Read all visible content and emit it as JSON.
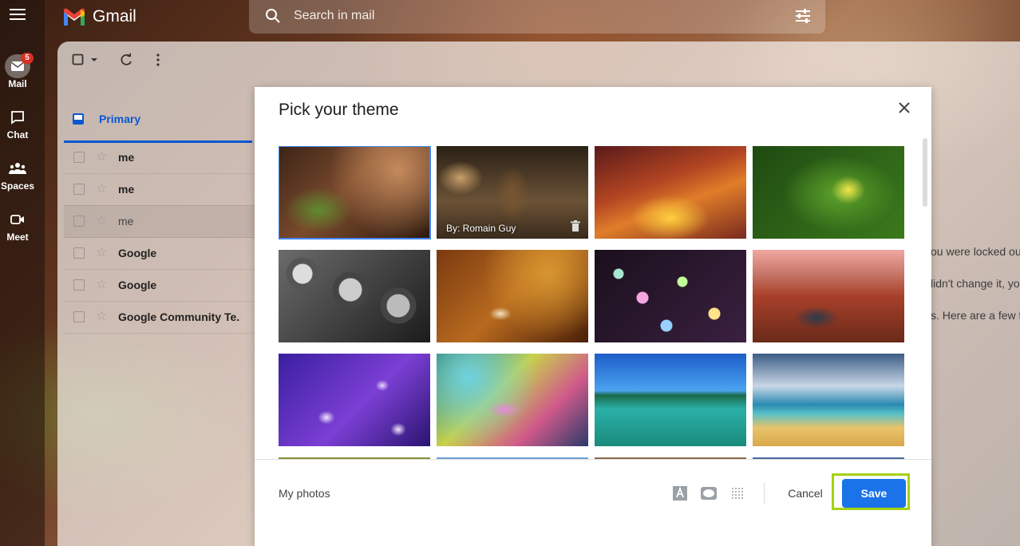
{
  "app": {
    "name": "Gmail"
  },
  "search": {
    "placeholder": "Search in mail"
  },
  "nav": {
    "items": [
      {
        "label": "Mail",
        "badge": "5"
      },
      {
        "label": "Chat"
      },
      {
        "label": "Spaces"
      },
      {
        "label": "Meet"
      }
    ]
  },
  "inbox": {
    "tab_label": "Primary",
    "rows": [
      {
        "sender": "me"
      },
      {
        "sender": "me"
      },
      {
        "sender": "me"
      },
      {
        "sender": "Google"
      },
      {
        "sender": "Google"
      },
      {
        "sender": "Google Community Te."
      }
    ],
    "snippets": [
      "ou were locked ou",
      "lidn't change it, yo",
      "s. Here are a few t"
    ]
  },
  "dialog": {
    "title": "Pick your theme",
    "themes": [
      {
        "name": "fern-leaves",
        "selected": true
      },
      {
        "name": "chess",
        "caption": "By: Romain Guy"
      },
      {
        "name": "canyon"
      },
      {
        "name": "caterpillar"
      },
      {
        "name": "pipes"
      },
      {
        "name": "autumn-leaves"
      },
      {
        "name": "bokeh"
      },
      {
        "name": "horseshoe-bend"
      },
      {
        "name": "jellyfish"
      },
      {
        "name": "water-drop"
      },
      {
        "name": "lake-trees"
      },
      {
        "name": "beach"
      }
    ],
    "my_photos": "My photos",
    "cancel": "Cancel",
    "save": "Save"
  },
  "colors": {
    "accent": "#1a73e8",
    "highlight": "#a5d20f",
    "badge": "#d93025"
  }
}
